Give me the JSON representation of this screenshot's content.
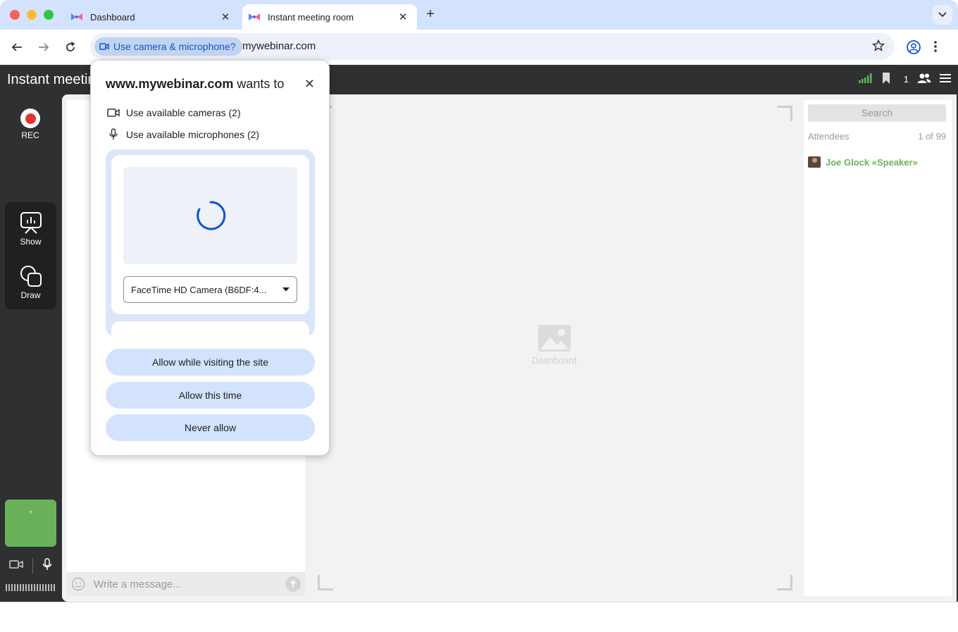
{
  "browser": {
    "tabs": [
      {
        "title": "Dashboard",
        "close": "✕"
      },
      {
        "title": "Instant meeting room",
        "close": "✕"
      }
    ],
    "new_tab": "+",
    "permission_chip": "Use camera & microphone?",
    "url": "mywebinar.com"
  },
  "app": {
    "title": "Instant meetir",
    "participant_count": "1",
    "rec_label": "REC",
    "tools": [
      {
        "label": "Show"
      },
      {
        "label": "Draw"
      }
    ],
    "camera_tile_text": "'",
    "chat_placeholder": "Write a message..."
  },
  "stage": {
    "placeholder_label": "Dashboard"
  },
  "attendees": {
    "search_placeholder": "Search",
    "label": "Attendees",
    "count": "1 of 99",
    "list": [
      {
        "name": "Joe Glock «Speaker»"
      }
    ]
  },
  "permission_popup": {
    "site": "www.mywebinar.com",
    "wants_to": "wants to",
    "close": "✕",
    "permissions": [
      {
        "icon": "video-camera-icon",
        "label": "Use available cameras (2)"
      },
      {
        "icon": "microphone-icon",
        "label": "Use available microphones (2)"
      }
    ],
    "camera_select_value": "FaceTime HD Camera (B6DF:4...",
    "buttons": {
      "allow_always": "Allow while visiting the site",
      "allow_once": "Allow this time",
      "never": "Never allow"
    }
  },
  "colors": {
    "accent_blue": "#0b57d0",
    "button_blue": "#d3e3fd",
    "tabstrip": "#d3e3fd",
    "app_dark": "#2f3032",
    "speaker_green": "#6ab25a",
    "rec_red": "#e8322b"
  }
}
